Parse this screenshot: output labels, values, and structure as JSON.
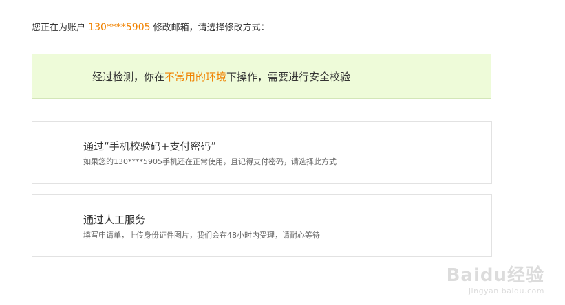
{
  "header": {
    "prefix": "您正在为账户",
    "phone": "130****5905",
    "suffix": "修改邮箱，请选择修改方式："
  },
  "alert": {
    "before": "经过检测，你在",
    "highlight": "不常用的环境",
    "after": "下操作，需要进行安全校验"
  },
  "options": [
    {
      "title": "通过“手机校验码+支付密码”",
      "description": "如果您的130****5905手机还在正常使用，且记得支付密码，请选择此方式"
    },
    {
      "title": "通过人工服务",
      "description": "填写申请单，上传身份证件图片，我们会在48小时内受理，请耐心等待"
    }
  ],
  "watermark": {
    "brand": "Baidu经验",
    "url": "jingyan.baidu.com"
  },
  "colors": {
    "accent": "#f08200",
    "alert_bg": "#eefbd9",
    "alert_border": "#d3e6b8",
    "card_border": "#e2e2e2"
  }
}
